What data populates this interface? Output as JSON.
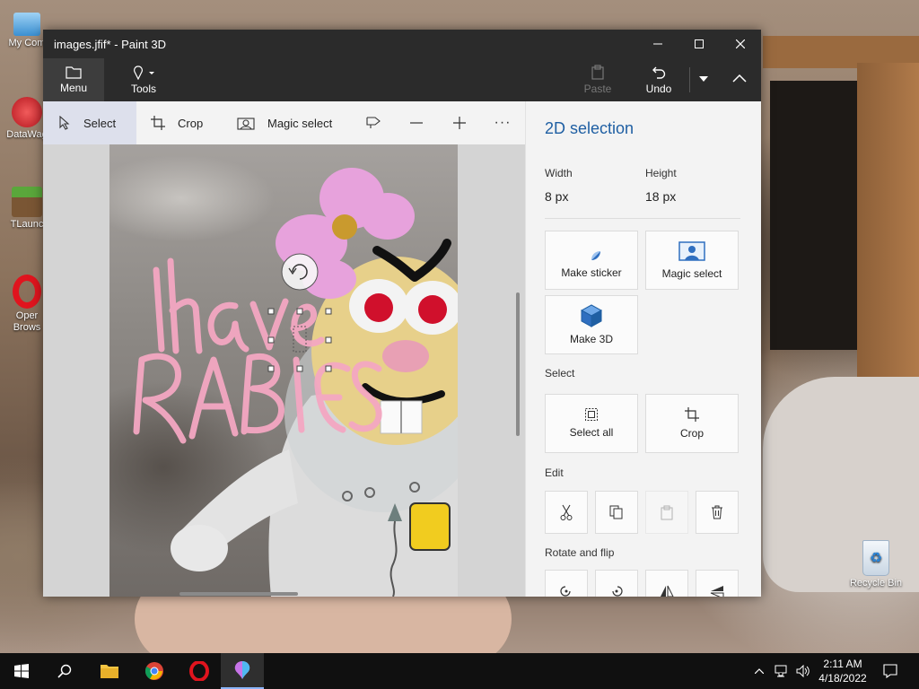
{
  "window": {
    "title": "images.jfif* - Paint 3D",
    "minimize": "—",
    "maximize": "☐",
    "close": "✕"
  },
  "ribbon": {
    "menu_label": "Menu",
    "tools_label": "Tools",
    "paste_label": "Paste",
    "undo_label": "Undo"
  },
  "toolbar": {
    "select_label": "Select",
    "crop_label": "Crop",
    "magic_select_label": "Magic select",
    "more_label": "···"
  },
  "image_text": {
    "line1": "I have",
    "line2": "RABIES"
  },
  "panel": {
    "title": "2D selection",
    "width_label": "Width",
    "width_value": "8 px",
    "height_label": "Height",
    "height_value": "18 px",
    "make_sticker": "Make sticker",
    "magic_select": "Magic select",
    "make_3d": "Make 3D",
    "select_heading": "Select",
    "select_all": "Select all",
    "crop": "Crop",
    "edit_heading": "Edit",
    "rotate_heading": "Rotate and flip"
  },
  "desktop": {
    "icons": [
      {
        "label1": "My Com",
        "label2": ""
      },
      {
        "label1": "DataWag",
        "label2": ""
      },
      {
        "label1": "TLaunc",
        "label2": ""
      },
      {
        "label1": "Oper",
        "label2": "Brows"
      }
    ],
    "recycle_bin": "Recycle Bin"
  },
  "taskbar": {
    "time": "2:11 AM",
    "date": "4/18/2022"
  },
  "colors": {
    "accent": "#1f5fa3",
    "titlebar": "#2b2b2b",
    "sticker_blue": "#2f6fc0",
    "ink_pink": "#f4a7c2"
  }
}
